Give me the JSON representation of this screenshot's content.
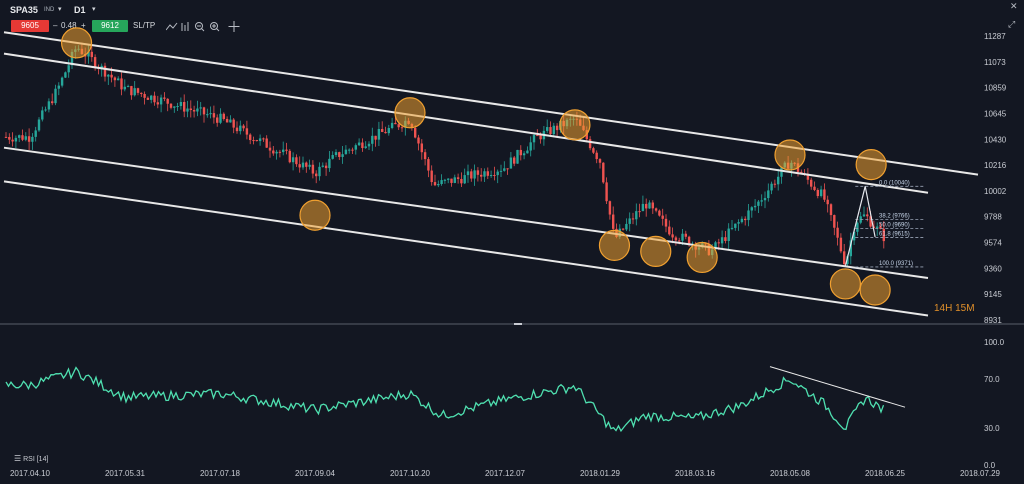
{
  "toolbar": {
    "symbol": "SPA35",
    "exchange": "IND",
    "timeframe": "D1",
    "sell_price": "9605",
    "spread": "0.48",
    "buy_price": "9612",
    "sltp_label": "SL/TP",
    "minus": "–",
    "plus": "+"
  },
  "window_icons": {
    "close": "✕",
    "expand": "⤢"
  },
  "timer": "14H 15M",
  "rsi_label": "RSI [14]",
  "colors": {
    "background": "#131722",
    "bull": "#26a69a",
    "bear": "#ef5350",
    "channel": "#e8e8e8",
    "highlight": "#f0a030",
    "rsi": "#4fe0b0",
    "sell": "#e53935",
    "buy": "#26a65b"
  },
  "chart_data": [
    {
      "type": "candlestick",
      "title": "",
      "x_dates": [
        "2017.04.10",
        "2017.05.31",
        "2017.07.18",
        "2017.09.04",
        "2017.10.20",
        "2017.12.07",
        "2018.01.29",
        "2018.03.16",
        "2018.05.08",
        "2018.06.25",
        "2018.07.29"
      ],
      "y_ticks": [
        11287,
        11073,
        10859,
        10645,
        10430,
        10216,
        10002,
        9788,
        9574,
        9360,
        9145,
        8931
      ],
      "ylim": [
        8931,
        11287
      ],
      "key_points": [
        {
          "date": "2017.04.10",
          "close": 10450
        },
        {
          "date": "2017.04.25",
          "close": 10850
        },
        {
          "date": "2017.05.05",
          "close": 11200
        },
        {
          "date": "2017.05.31",
          "close": 10850
        },
        {
          "date": "2017.07.18",
          "close": 10600
        },
        {
          "date": "2017.08.20",
          "close": 10300
        },
        {
          "date": "2017.09.04",
          "close": 10150
        },
        {
          "date": "2017.09.15",
          "close": 10300
        },
        {
          "date": "2017.10.20",
          "close": 10600
        },
        {
          "date": "2017.11.01",
          "close": 10050
        },
        {
          "date": "2017.12.07",
          "close": 10200
        },
        {
          "date": "2017.12.25",
          "close": 10450
        },
        {
          "date": "2018.01.15",
          "close": 10600
        },
        {
          "date": "2018.01.29",
          "close": 10250
        },
        {
          "date": "2018.02.05",
          "close": 9600
        },
        {
          "date": "2018.02.20",
          "close": 9900
        },
        {
          "date": "2018.03.05",
          "close": 9650
        },
        {
          "date": "2018.03.25",
          "close": 9500
        },
        {
          "date": "2018.04.20",
          "close": 9900
        },
        {
          "date": "2018.05.08",
          "close": 10250
        },
        {
          "date": "2018.05.25",
          "close": 9950
        },
        {
          "date": "2018.06.05",
          "close": 9400
        },
        {
          "date": "2018.06.10",
          "close": 9750
        },
        {
          "date": "2018.06.15",
          "close": 9800
        },
        {
          "date": "2018.06.25",
          "close": 9610
        }
      ],
      "fibonacci": [
        {
          "label": "0.0 (10040)",
          "value": 10040
        },
        {
          "label": "38.2 (9766)",
          "value": 9766
        },
        {
          "label": "50.0 (9690)",
          "value": 9690
        },
        {
          "label": "61.8 (9615)",
          "value": 9615
        },
        {
          "label": "100.0 (9371)",
          "value": 9371
        }
      ]
    },
    {
      "type": "line",
      "series": [
        {
          "name": "RSI [14]"
        }
      ],
      "y_ticks": [
        100,
        70,
        30,
        0
      ],
      "y_tick_labels": [
        "100.0",
        "70.0",
        "30.0",
        "0.0"
      ],
      "ylim": [
        0,
        100
      ],
      "key_points": [
        {
          "date": "2017.04.10",
          "value": 65
        },
        {
          "date": "2017.05.05",
          "value": 76
        },
        {
          "date": "2017.05.31",
          "value": 55
        },
        {
          "date": "2017.07.18",
          "value": 58
        },
        {
          "date": "2017.09.04",
          "value": 45
        },
        {
          "date": "2017.10.20",
          "value": 58
        },
        {
          "date": "2017.11.05",
          "value": 40
        },
        {
          "date": "2017.12.07",
          "value": 53
        },
        {
          "date": "2018.01.15",
          "value": 64
        },
        {
          "date": "2018.02.05",
          "value": 27
        },
        {
          "date": "2018.02.20",
          "value": 40
        },
        {
          "date": "2018.03.16",
          "value": 38
        },
        {
          "date": "2018.04.10",
          "value": 48
        },
        {
          "date": "2018.05.08",
          "value": 70
        },
        {
          "date": "2018.05.25",
          "value": 50
        },
        {
          "date": "2018.06.05",
          "value": 30
        },
        {
          "date": "2018.06.15",
          "value": 55
        },
        {
          "date": "2018.06.25",
          "value": 44
        }
      ]
    }
  ]
}
